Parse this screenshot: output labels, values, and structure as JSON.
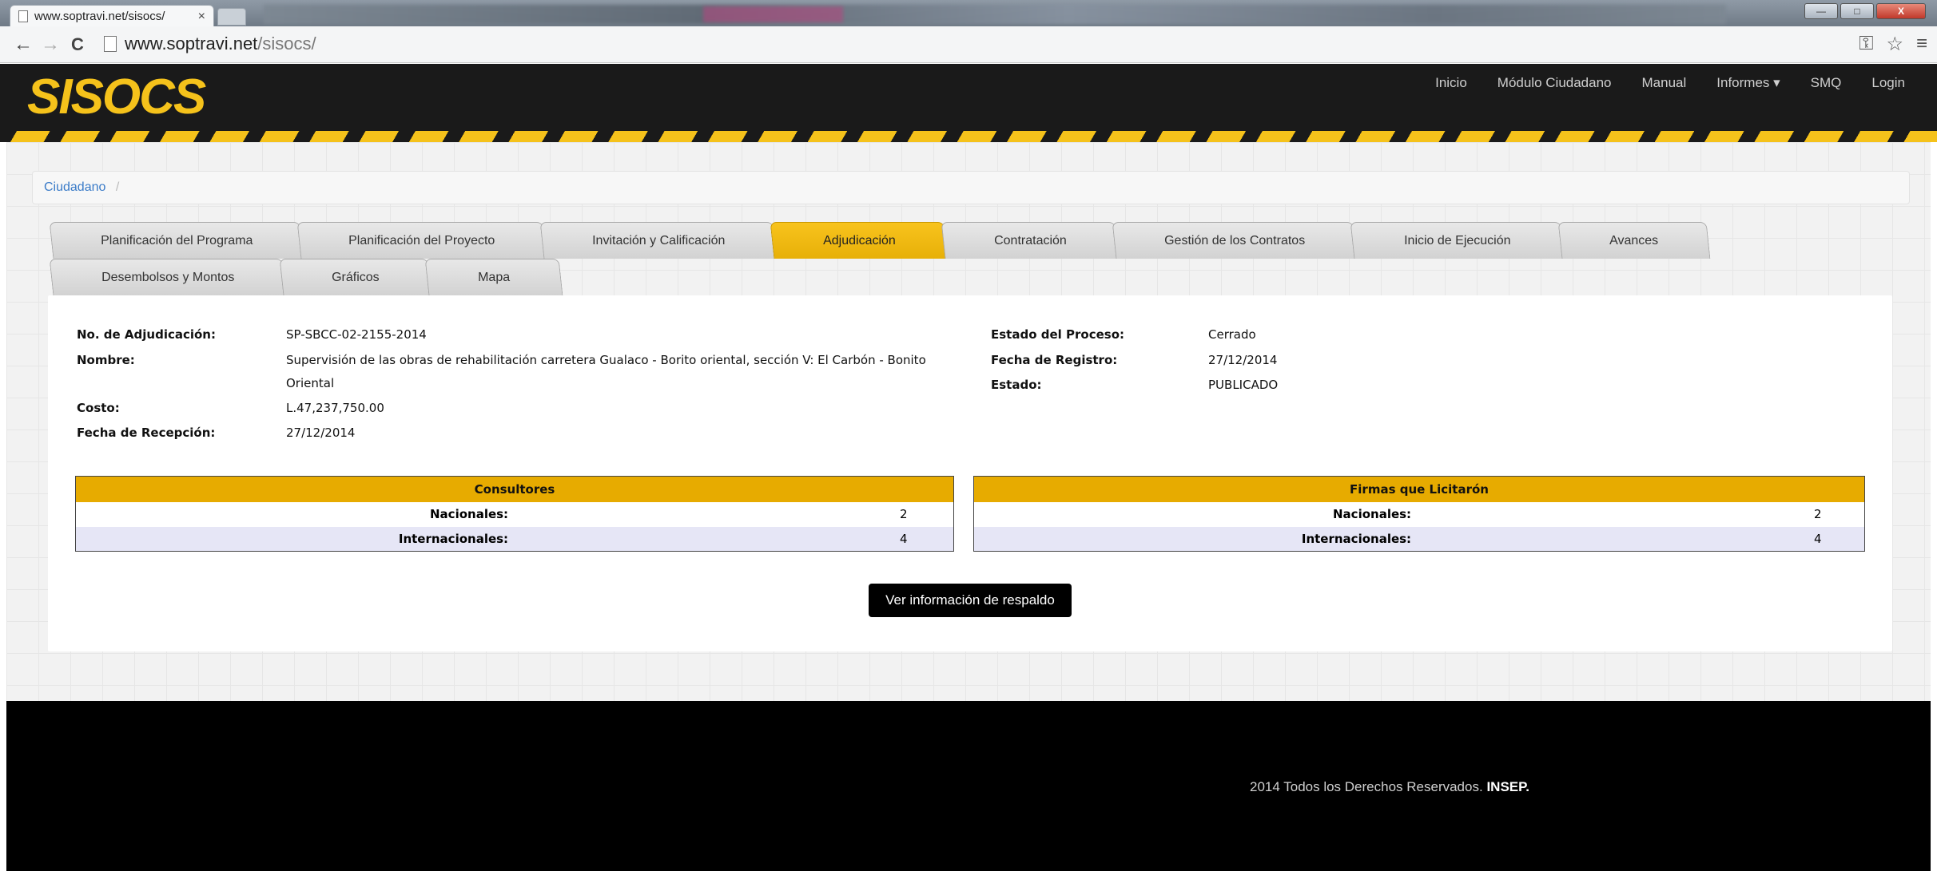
{
  "browser": {
    "tab_title": "www.soptravi.net/sisocs/",
    "tab_close": "×",
    "url_host": "www.soptravi.net",
    "url_path": "/sisocs/",
    "back": "←",
    "forward": "→",
    "reload": "C",
    "key_icon": "⚿",
    "star_icon": "☆",
    "menu_icon": "≡",
    "win_min": "—",
    "win_max": "□",
    "win_close": "X"
  },
  "site": {
    "logo": "SISOCS",
    "nav": [
      "Inicio",
      "Módulo Ciudadano",
      "Manual",
      "Informes ▾",
      "SMQ",
      "Login"
    ]
  },
  "breadcrumb": {
    "item": "Ciudadano",
    "separator": "/"
  },
  "tabs": {
    "row1": [
      {
        "label": "Planificación del Programa",
        "active": false
      },
      {
        "label": "Planificación del Proyecto",
        "active": false
      },
      {
        "label": "Invitación y Calificación",
        "active": false
      },
      {
        "label": "Adjudicación",
        "active": true
      },
      {
        "label": "Contratación",
        "active": false
      },
      {
        "label": "Gestión de los Contratos",
        "active": false
      },
      {
        "label": "Inicio de Ejecución",
        "active": false
      },
      {
        "label": "Avances",
        "active": false
      }
    ],
    "row2": [
      {
        "label": "Desembolsos y Montos",
        "active": false
      },
      {
        "label": "Gráficos",
        "active": false
      },
      {
        "label": "Mapa",
        "active": false
      }
    ]
  },
  "details": {
    "adjudicacion_label": "No. de Adjudicación:",
    "adjudicacion_value": "SP-SBCC-02-2155-2014",
    "nombre_label": "Nombre:",
    "nombre_value_1": "Supervisión de las obras de rehabilitación carretera Gualaco - Borito oriental, sección V: El Carbón - Bonito",
    "nombre_value_2": "Oriental",
    "costo_label": "Costo:",
    "costo_value": "L.47,237,750.00",
    "recepcion_label": "Fecha de Recepción:",
    "recepcion_value": "27/12/2014",
    "estado_proceso_label": "Estado del Proceso:",
    "estado_proceso_value": "Cerrado",
    "registro_label": "Fecha de Registro:",
    "registro_value": "27/12/2014",
    "estado_label": "Estado:",
    "estado_value": "PUBLICADO"
  },
  "consultores": {
    "title": "Consultores",
    "rows": [
      {
        "label": "Nacionales:",
        "value": "2"
      },
      {
        "label": "Internacionales:",
        "value": "4"
      }
    ]
  },
  "firmas": {
    "title": "Firmas que Licitarón",
    "rows": [
      {
        "label": "Nacionales:",
        "value": "2"
      },
      {
        "label": "Internacionales:",
        "value": "4"
      }
    ]
  },
  "button": {
    "label": "Ver información de respaldo"
  },
  "footer": {
    "text": "2014 Todos los Derechos Reservados.",
    "brand": "INSEP."
  },
  "colors": {
    "accent": "#f5c21b",
    "header_bg": "#1a1a1a",
    "table_header": "#e7ab00"
  }
}
